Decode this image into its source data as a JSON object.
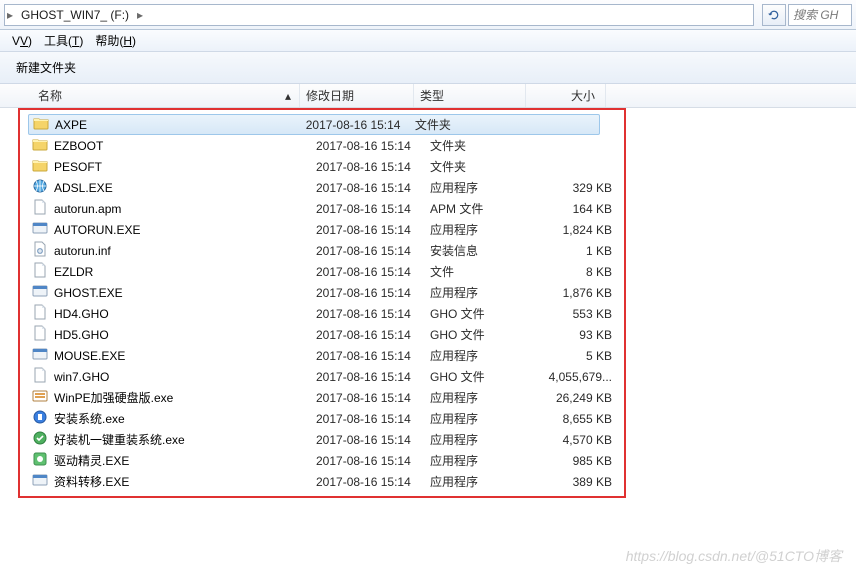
{
  "address": {
    "crumb": "GHOST_WIN7_ (F:)"
  },
  "search": {
    "placeholder": "搜索 GH"
  },
  "menu": {
    "view": {
      "label": "V",
      "ak": "V",
      "suffix": ")"
    },
    "tools": {
      "label": "工具(",
      "ak": "T",
      "suffix": ")"
    },
    "help": {
      "label": "帮助(",
      "ak": "H",
      "suffix": ")"
    }
  },
  "toolbar": {
    "new_folder": "新建文件夹"
  },
  "columns": {
    "name": "名称",
    "date": "修改日期",
    "type": "类型",
    "size": "大小"
  },
  "files": [
    {
      "icon": "folder",
      "name": "AXPE",
      "date": "2017-08-16 15:14",
      "type": "文件夹",
      "size": "",
      "selected": true
    },
    {
      "icon": "folder",
      "name": "EZBOOT",
      "date": "2017-08-16 15:14",
      "type": "文件夹",
      "size": ""
    },
    {
      "icon": "folder",
      "name": "PESOFT",
      "date": "2017-08-16 15:14",
      "type": "文件夹",
      "size": ""
    },
    {
      "icon": "exe-net",
      "name": "ADSL.EXE",
      "date": "2017-08-16 15:14",
      "type": "应用程序",
      "size": "329 KB"
    },
    {
      "icon": "file",
      "name": "autorun.apm",
      "date": "2017-08-16 15:14",
      "type": "APM 文件",
      "size": "164 KB"
    },
    {
      "icon": "exe",
      "name": "AUTORUN.EXE",
      "date": "2017-08-16 15:14",
      "type": "应用程序",
      "size": "1,824 KB"
    },
    {
      "icon": "inf",
      "name": "autorun.inf",
      "date": "2017-08-16 15:14",
      "type": "安装信息",
      "size": "1 KB"
    },
    {
      "icon": "file",
      "name": "EZLDR",
      "date": "2017-08-16 15:14",
      "type": "文件",
      "size": "8 KB"
    },
    {
      "icon": "exe",
      "name": "GHOST.EXE",
      "date": "2017-08-16 15:14",
      "type": "应用程序",
      "size": "1,876 KB"
    },
    {
      "icon": "file",
      "name": "HD4.GHO",
      "date": "2017-08-16 15:14",
      "type": "GHO 文件",
      "size": "553 KB"
    },
    {
      "icon": "file",
      "name": "HD5.GHO",
      "date": "2017-08-16 15:14",
      "type": "GHO 文件",
      "size": "93 KB"
    },
    {
      "icon": "exe",
      "name": "MOUSE.EXE",
      "date": "2017-08-16 15:14",
      "type": "应用程序",
      "size": "5 KB"
    },
    {
      "icon": "file",
      "name": "win7.GHO",
      "date": "2017-08-16 15:14",
      "type": "GHO 文件",
      "size": "4,055,679..."
    },
    {
      "icon": "exe-pe",
      "name": "WinPE加强硬盘版.exe",
      "date": "2017-08-16 15:14",
      "type": "应用程序",
      "size": "26,249 KB"
    },
    {
      "icon": "exe-blue",
      "name": "安装系统.exe",
      "date": "2017-08-16 15:14",
      "type": "应用程序",
      "size": "8,655 KB"
    },
    {
      "icon": "exe-grn",
      "name": "好装机一键重装系统.exe",
      "date": "2017-08-16 15:14",
      "type": "应用程序",
      "size": "4,570 KB"
    },
    {
      "icon": "exe-drv",
      "name": "驱动精灵.EXE",
      "date": "2017-08-16 15:14",
      "type": "应用程序",
      "size": "985 KB"
    },
    {
      "icon": "exe",
      "name": "资料转移.EXE",
      "date": "2017-08-16 15:14",
      "type": "应用程序",
      "size": "389 KB"
    }
  ],
  "watermark": "https://blog.csdn.net/@51CTO博客"
}
